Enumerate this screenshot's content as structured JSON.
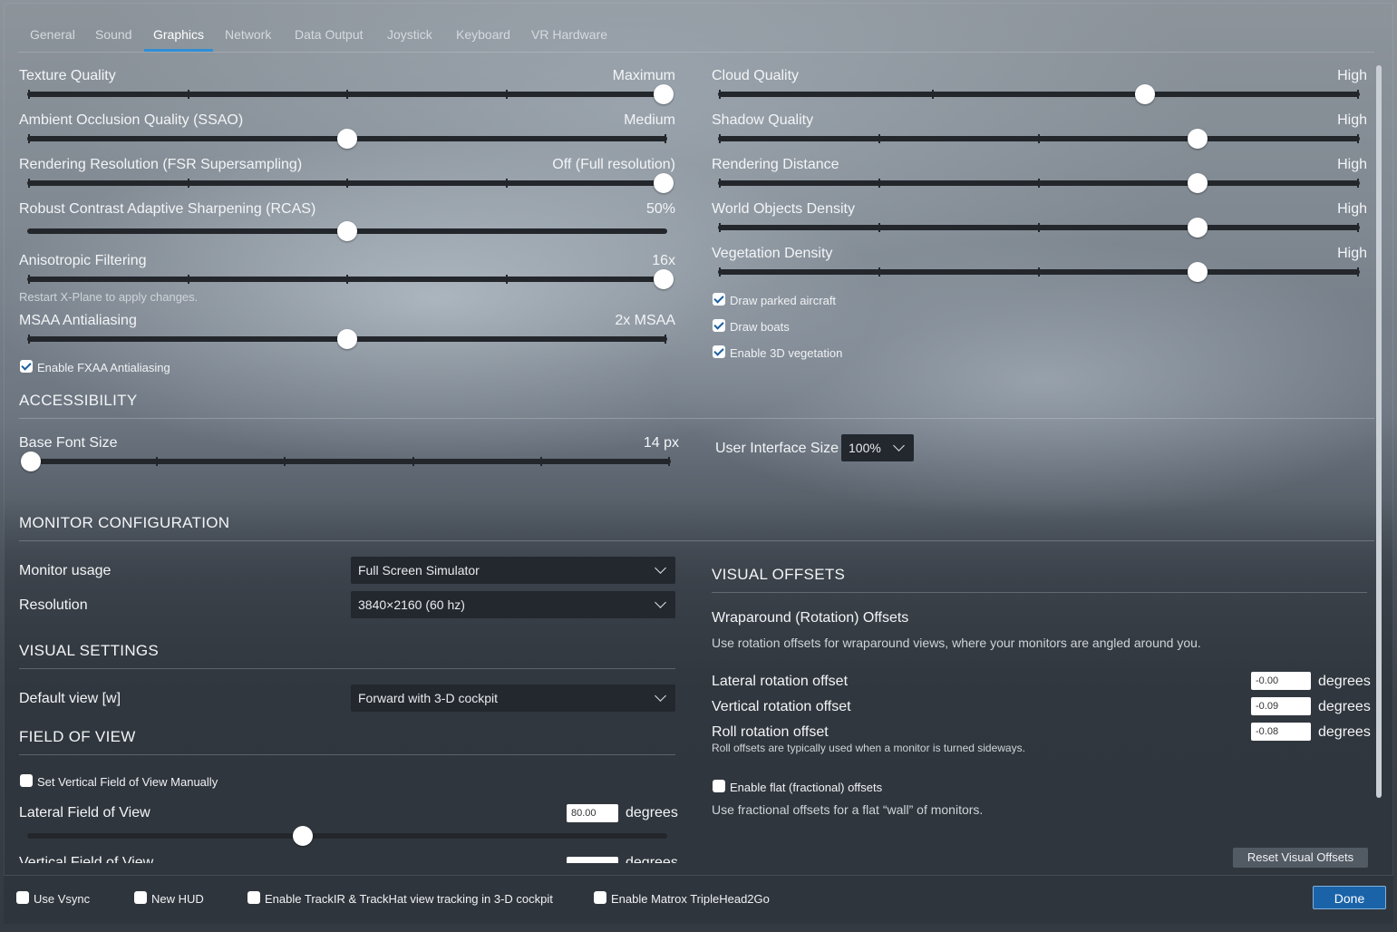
{
  "tabs": [
    "General",
    "Sound",
    "Graphics",
    "Network",
    "Data Output",
    "Joystick",
    "Keyboard",
    "VR Hardware"
  ],
  "active_tab": "Graphics",
  "left_sliders": {
    "texture": {
      "label": "Texture Quality",
      "value": "Maximum",
      "level": 1.0
    },
    "ssao": {
      "label": "Ambient Occlusion Quality (SSAO)",
      "value": "Medium",
      "level": 0.5
    },
    "fsr": {
      "label": "Rendering Resolution (FSR Supersampling)",
      "value": "Off (Full resolution)",
      "level": 1.0
    },
    "rcas": {
      "label": "Robust Contrast Adaptive Sharpening (RCAS)",
      "value": "50%",
      "level": 0.5
    },
    "aniso": {
      "label": "Anisotropic Filtering",
      "value": "16x",
      "level": 1.0
    },
    "restart_hint": "Restart X-Plane to apply changes.",
    "msaa": {
      "label": "MSAA Antialiasing",
      "value": "2x MSAA",
      "level": 0.5
    }
  },
  "fxaa": {
    "label": "Enable FXAA Antialiasing",
    "checked": true
  },
  "right_sliders": {
    "cloud": {
      "label": "Cloud Quality",
      "value": "High",
      "level": 0.667
    },
    "shadow": {
      "label": "Shadow Quality",
      "value": "High",
      "level": 0.75
    },
    "distance": {
      "label": "Rendering Distance",
      "value": "High",
      "level": 0.75
    },
    "objects": {
      "label": "World Objects Density",
      "value": "High",
      "level": 0.75
    },
    "vegetation": {
      "label": "Vegetation Density",
      "value": "High",
      "level": 0.75
    }
  },
  "right_checks": {
    "parked": {
      "label": "Draw parked aircraft",
      "checked": true
    },
    "boats": {
      "label": "Draw boats",
      "checked": true
    },
    "veg3d": {
      "label": "Enable 3D vegetation",
      "checked": true
    }
  },
  "accessibility": {
    "title": "ACCESSIBILITY",
    "font_label": "Base Font Size",
    "font_value": "14 px",
    "font_level": 0.0,
    "ui_size_label": "User Interface Size",
    "ui_size_value": "100%"
  },
  "monitor": {
    "title": "MONITOR CONFIGURATION",
    "usage_label": "Monitor usage",
    "usage_value": "Full Screen Simulator",
    "res_label": "Resolution",
    "res_value": "3840×2160 (60 hz)"
  },
  "visual_settings": {
    "title": "VISUAL SETTINGS",
    "default_view_label": "Default view [w]",
    "default_view_value": "Forward with 3-D cockpit"
  },
  "fov": {
    "title": "FIELD OF VIEW",
    "manual_label": "Set Vertical Field of View Manually",
    "manual_checked": false,
    "lateral_label": "Lateral Field of View",
    "lateral_value": "80.00",
    "lateral_unit": "degrees",
    "lateral_level": 0.43,
    "vertical_label": "Vertical Field of View",
    "vertical_unit": "degrees"
  },
  "visual_offsets": {
    "title": "VISUAL OFFSETS",
    "wrap_title": "Wraparound (Rotation) Offsets",
    "wrap_desc": "Use rotation offsets for wraparound views, where your monitors are angled around you.",
    "lateral_label": "Lateral rotation offset",
    "lateral_value": "-0.00",
    "vertical_label": "Vertical rotation offset",
    "vertical_value": "-0.09",
    "roll_label": "Roll rotation offset",
    "roll_value": "-0.08",
    "unit": "degrees",
    "roll_hint": "Roll offsets are typically used when a monitor is turned sideways.",
    "flat_label": "Enable flat (fractional) offsets",
    "flat_checked": false,
    "flat_desc": "Use fractional offsets for a flat “wall” of monitors.",
    "reset_label": "Reset Visual Offsets"
  },
  "footer": {
    "vsync": "Use Vsync",
    "hud": "New HUD",
    "trackir": "Enable TrackIR & TrackHat view tracking in 3-D cockpit",
    "matrox": "Enable Matrox TripleHead2Go",
    "done": "Done"
  },
  "colors": {
    "accent": "#2f8fd6",
    "button": "#1a63a8",
    "track": "#23272c"
  }
}
